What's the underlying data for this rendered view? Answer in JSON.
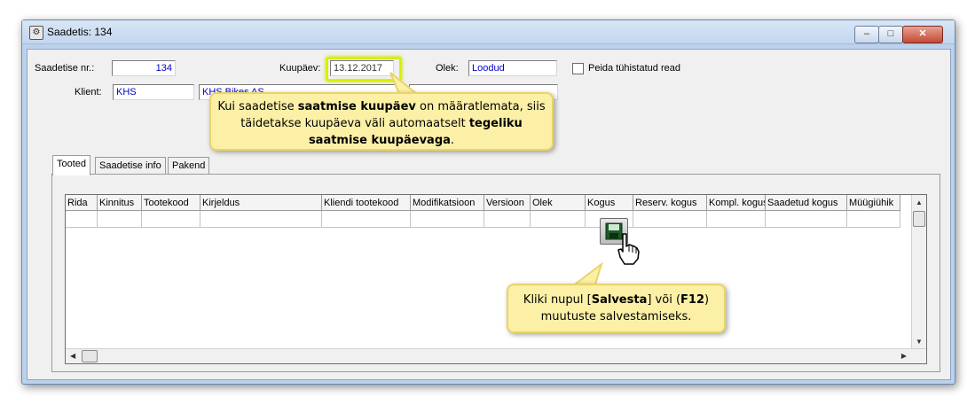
{
  "window": {
    "title": "Saadetis: 134",
    "controls": {
      "minimize": "–",
      "maximize": "□",
      "close": "✕"
    }
  },
  "form": {
    "saadetise_nr_label": "Saadetise nr.:",
    "saadetise_nr_value": "134",
    "kuupaev_label": "Kuupäev:",
    "kuupaev_value": "13.12.2017",
    "olek_label": "Olek:",
    "olek_value": "Loodud",
    "peida_label": "Peida tühistatud read",
    "klient_label": "Klient:",
    "klient_code": "KHS",
    "klient_name": "KHS Bikes AS"
  },
  "tabs": [
    "Tooted",
    "Saadetise info",
    "Pakend"
  ],
  "grid": {
    "columns": [
      "Rida",
      "Kinnitus",
      "Tootekood",
      "Kirjeldus",
      "Kliendi tootekood",
      "Modifikatsioon",
      "Versioon",
      "Olek",
      "Kogus",
      "Reserv. kogus",
      "Kompl. kogus",
      "Saadetud kogus",
      "Müügiühik"
    ]
  },
  "callouts": {
    "top_pre": "Kui saadetise ",
    "top_b1": "saatmise kuupäev",
    "top_mid": " on määratlemata, siis täidetakse kuupäeva väli automaatselt ",
    "top_b2": "tegeliku saatmise kuupäevaga",
    "top_end": ".",
    "bottom_pre": "Kliki nupul [",
    "bottom_b1": "Salvesta",
    "bottom_mid": "] või (",
    "bottom_b2": "F12",
    "bottom_end": ") muutuste salvestamiseks."
  },
  "icons": {
    "save": "save-icon",
    "cursor": "hand-pointer-icon",
    "window": "app-icon"
  }
}
